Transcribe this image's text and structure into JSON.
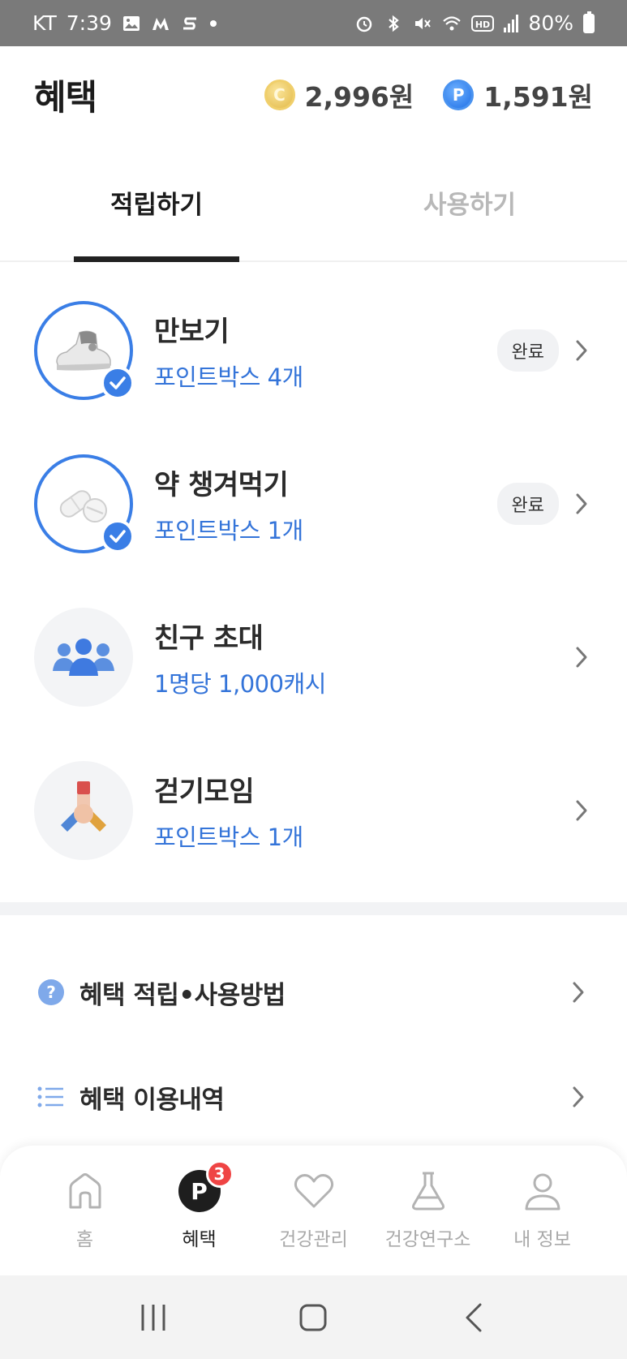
{
  "status_bar": {
    "carrier": "KT",
    "time": "7:39",
    "battery": "80%"
  },
  "header": {
    "title": "혜택",
    "cash_balance": "2,996원",
    "point_balance": "1,591원",
    "cash_coin_letter": "C",
    "point_coin_letter": "P"
  },
  "tabs": [
    {
      "label": "적립하기",
      "active": true
    },
    {
      "label": "사용하기",
      "active": false
    }
  ],
  "tasks": [
    {
      "title": "만보기",
      "subtitle": "포인트박스 4개",
      "status": "완료",
      "icon": "sneaker-icon",
      "done": true
    },
    {
      "title": "약 챙겨먹기",
      "subtitle": "포인트박스 1개",
      "status": "완료",
      "icon": "pills-icon",
      "done": true
    },
    {
      "title": "친구 초대",
      "subtitle": "1명당 1,000캐시",
      "status": "",
      "icon": "people-icon",
      "done": false
    },
    {
      "title": "걷기모임",
      "subtitle": "포인트박스 1개",
      "status": "",
      "icon": "team-hands-icon",
      "done": false
    }
  ],
  "menu": [
    {
      "label": "혜택 적립•사용방법",
      "icon": "question-icon"
    },
    {
      "label": "혜택 이용내역",
      "icon": "list-icon"
    }
  ],
  "bottom_nav": [
    {
      "label": "홈",
      "icon": "home-icon",
      "active": false
    },
    {
      "label": "혜택",
      "icon": "points-icon",
      "active": true,
      "badge": "3",
      "icon_letter": "P"
    },
    {
      "label": "건강관리",
      "icon": "heart-icon",
      "active": false
    },
    {
      "label": "건강연구소",
      "icon": "flask-icon",
      "active": false
    },
    {
      "label": "내 정보",
      "icon": "person-icon",
      "active": false
    }
  ],
  "colors": {
    "accent_blue": "#3474d9",
    "badge_red": "#ef4444",
    "status_bar": "#7a7a7a"
  }
}
